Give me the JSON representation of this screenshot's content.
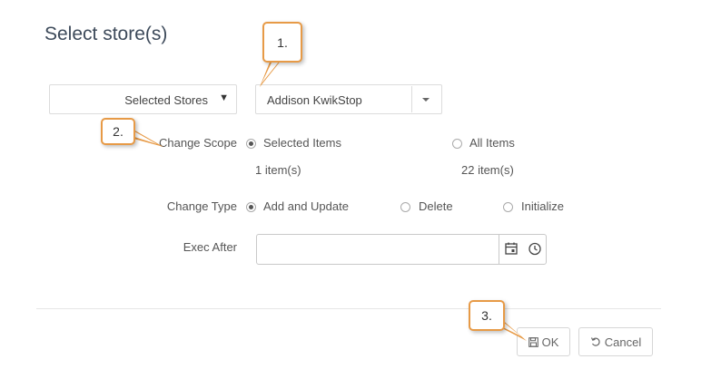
{
  "title": "Select store(s)",
  "store_filter": {
    "value": "Selected Stores",
    "arrow": "▼"
  },
  "store_picker": {
    "value": "Addison KwikStop"
  },
  "change_scope": {
    "label": "Change Scope",
    "options": [
      {
        "label": "Selected Items",
        "count": "1 item(s)",
        "selected": true
      },
      {
        "label": "All Items",
        "count": "22 item(s)",
        "selected": false
      }
    ]
  },
  "change_type": {
    "label": "Change Type",
    "options": [
      {
        "label": "Add and Update",
        "selected": true
      },
      {
        "label": "Delete",
        "selected": false
      },
      {
        "label": "Initialize",
        "selected": false
      }
    ]
  },
  "exec_after": {
    "label": "Exec After",
    "value": "",
    "icons": [
      "calendar-icon",
      "clock-icon"
    ]
  },
  "footer": {
    "ok_label": "OK",
    "cancel_label": "Cancel",
    "ok_icon": "save-icon",
    "cancel_icon": "undo-icon"
  },
  "callouts": [
    "1.",
    "2.",
    "3."
  ],
  "colors": {
    "callout_border": "#e79a46",
    "title": "#3d4a5a",
    "text": "#555555"
  }
}
